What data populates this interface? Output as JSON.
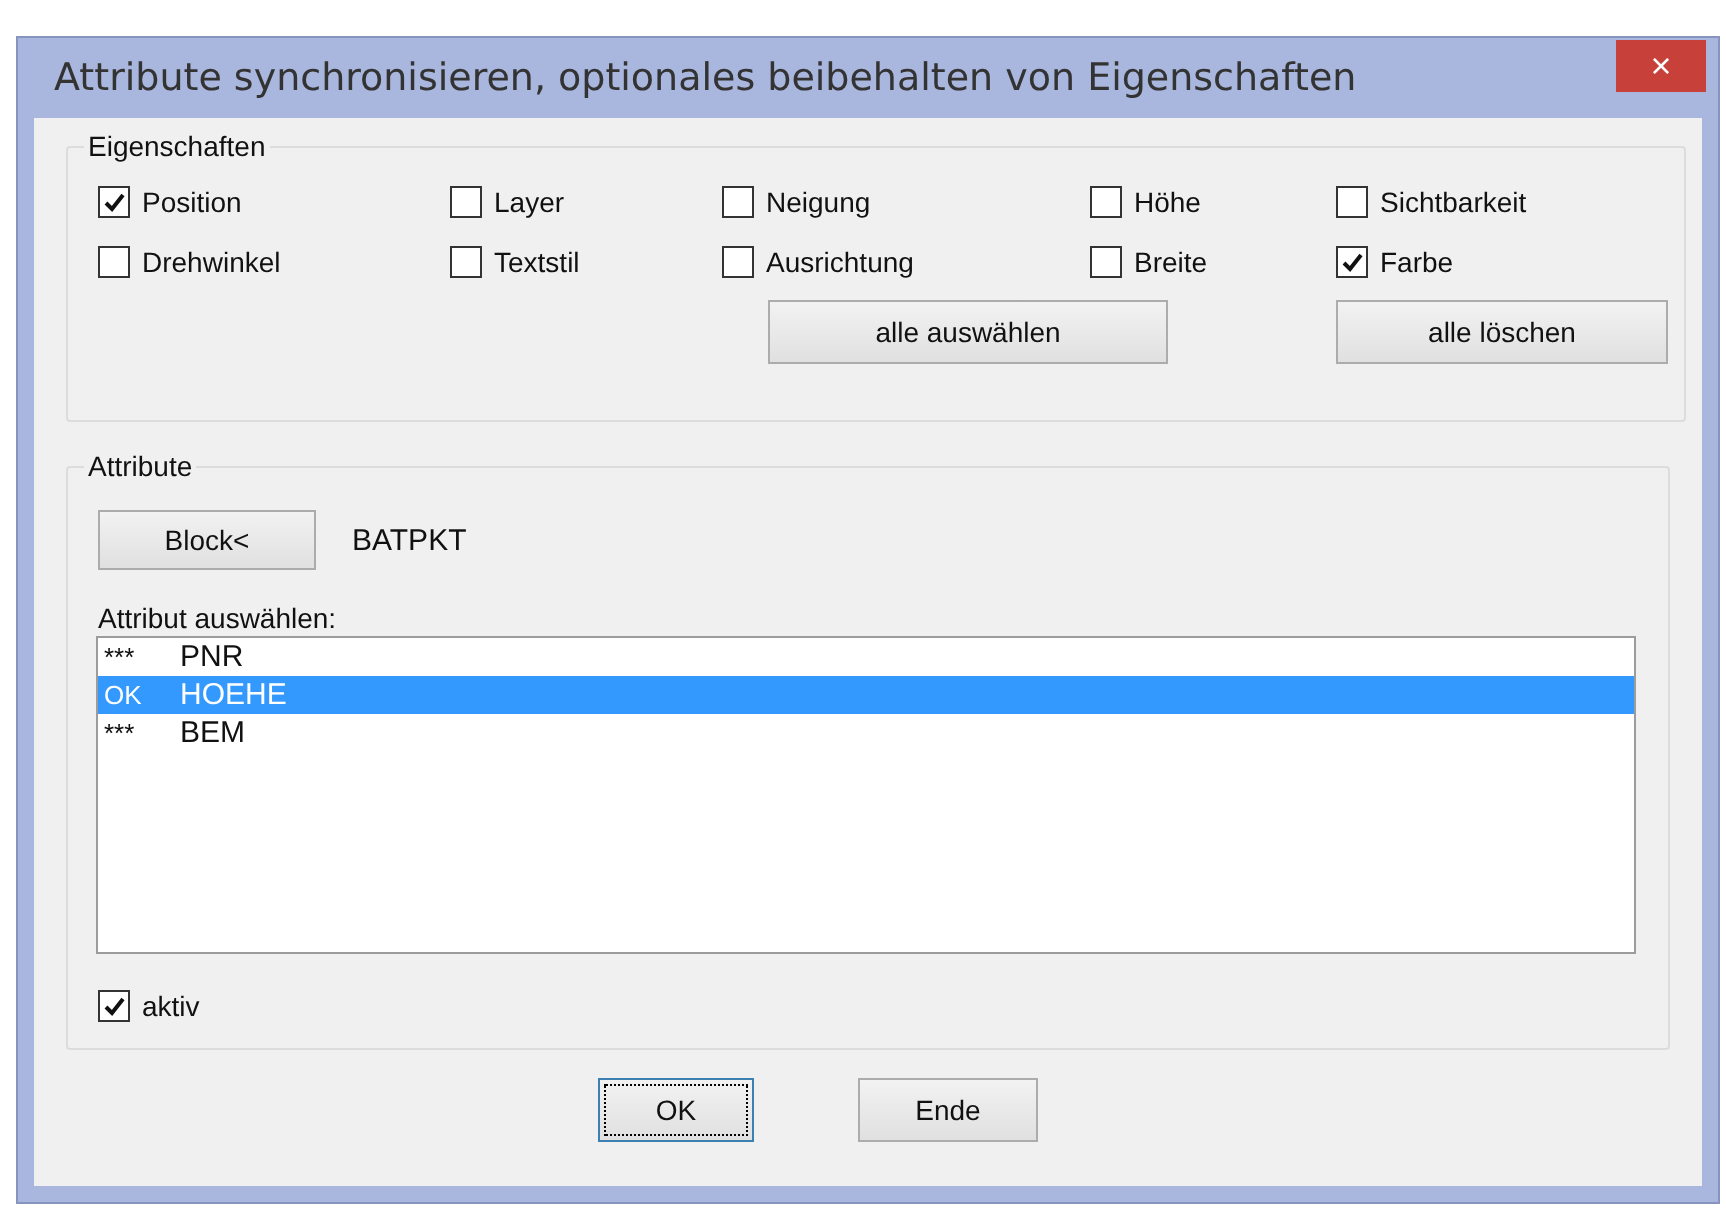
{
  "window": {
    "title": "Attribute synchronisieren, optionales beibehalten von Eigenschaften",
    "close": "×"
  },
  "properties": {
    "label": "Eigenschaften",
    "options": [
      {
        "label": "Position",
        "checked": true
      },
      {
        "label": "Layer",
        "checked": false
      },
      {
        "label": "Neigung",
        "checked": false
      },
      {
        "label": "Höhe",
        "checked": false
      },
      {
        "label": "Sichtbarkeit",
        "checked": false
      },
      {
        "label": "Drehwinkel",
        "checked": false
      },
      {
        "label": "Textstil",
        "checked": false
      },
      {
        "label": "Ausrichtung",
        "checked": false
      },
      {
        "label": "Breite",
        "checked": false
      },
      {
        "label": "Farbe",
        "checked": true
      }
    ],
    "buttons": [
      {
        "label": "alle auswählen"
      },
      {
        "label": "alle löschen"
      }
    ]
  },
  "attributes": {
    "label": "Attribute",
    "block_button": {
      "label": "Block<"
    },
    "block_name": "BATPKT",
    "list_label": "Attribut auswählen:",
    "items": [
      {
        "status": "***",
        "name": "PNR",
        "selected": false
      },
      {
        "status": "OK",
        "name": "HOEHE",
        "selected": true
      },
      {
        "status": "***",
        "name": "BEM",
        "selected": false
      }
    ],
    "active": {
      "label": "aktiv",
      "checked": true
    }
  },
  "buttons": [
    {
      "label": "OK",
      "focused": true
    },
    {
      "label": "Ende",
      "focused": false
    }
  ]
}
